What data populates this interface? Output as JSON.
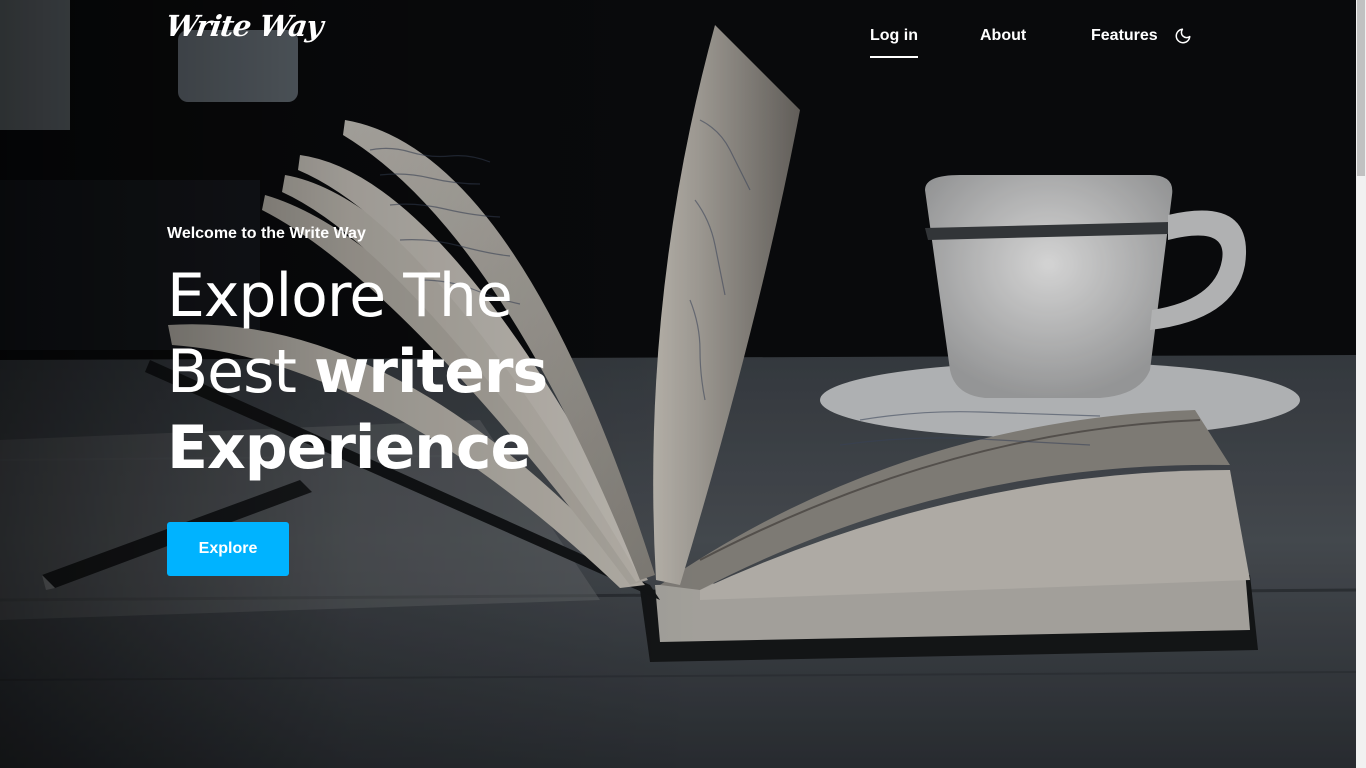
{
  "brand": {
    "logo_text": "Write Way"
  },
  "nav": {
    "items": [
      {
        "label": "Log in",
        "active": true
      },
      {
        "label": "About",
        "active": false
      },
      {
        "label": "Features",
        "active": false
      }
    ],
    "theme_toggle_icon": "moon-icon"
  },
  "hero": {
    "welcome": "Welcome to the Write Way",
    "headline": {
      "line1": "Explore The",
      "line2_light": "Best ",
      "line2_bold": "writers",
      "line3": "Experience"
    },
    "cta_label": "Explore"
  },
  "colors": {
    "accent": "#00b3ff",
    "text": "#ffffff",
    "background": "#0b0c0d"
  }
}
